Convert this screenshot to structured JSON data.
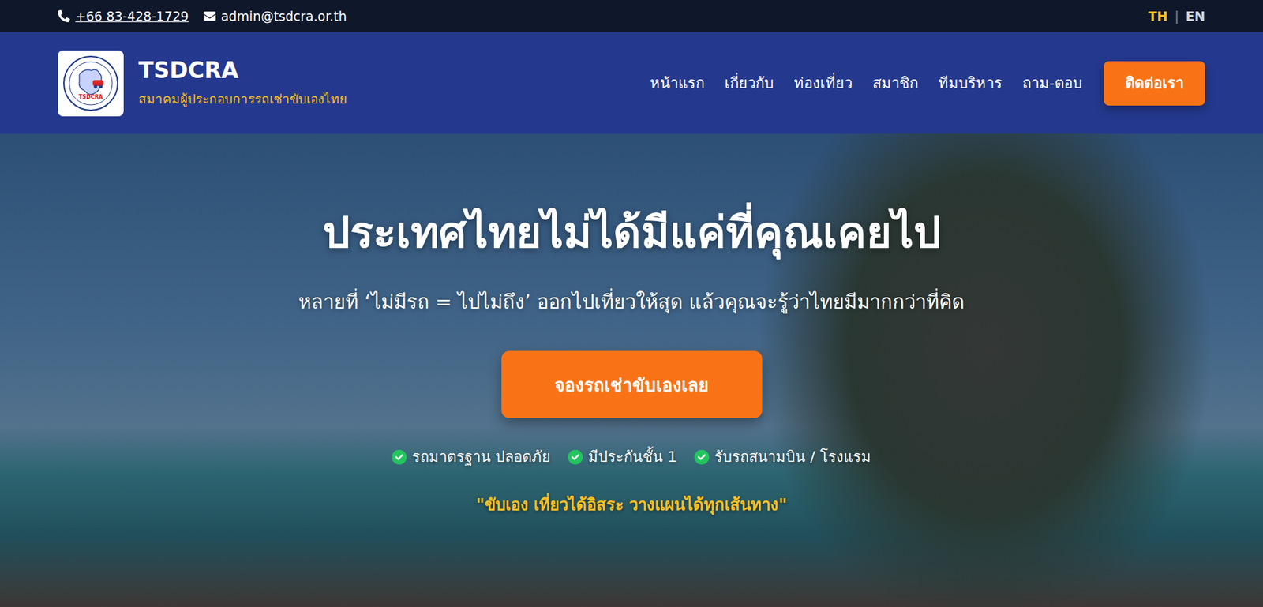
{
  "topbar": {
    "phone": "+66 83-428-1729",
    "email": "admin@tsdcra.or.th",
    "separator": "|",
    "languages": [
      {
        "label": "TH",
        "selected": true
      },
      {
        "label": "EN",
        "selected": false
      }
    ]
  },
  "header": {
    "logo": {
      "badge": "TSDCRA"
    },
    "brand": {
      "name": "TSDCRA",
      "tagline": "สมาคมผู้ประกอบการรถเช่าขับเองไทย"
    },
    "nav": [
      "หน้าแรก",
      "เกี่ยวกับ",
      "ท่องเที่ยว",
      "สมาชิก",
      "ทีมบริหาร",
      "ถาม-ตอบ"
    ],
    "contact_button": "ติดต่อเรา"
  },
  "hero": {
    "title": "ประเทศไทยไม่ได้มีแค่ที่คุณเคยไป",
    "subtitle": "หลายที่ ‘ไม่มีรถ = ไปไม่ถึง’ ออกไปเที่ยวให้สุด แล้วคุณจะรู้ว่าไทยมีมากกว่าที่คิด",
    "cta": "จองรถเช่าขับเองเลย",
    "features": [
      "รถมาตรฐาน ปลอดภัย",
      "มีประกันชั้น 1",
      "รับรถสนามบิน / โรงแรม"
    ],
    "quote": "\"ขับเอง เที่ยวได้อิสระ วางแผนได้ทุกเส้นทาง\""
  }
}
